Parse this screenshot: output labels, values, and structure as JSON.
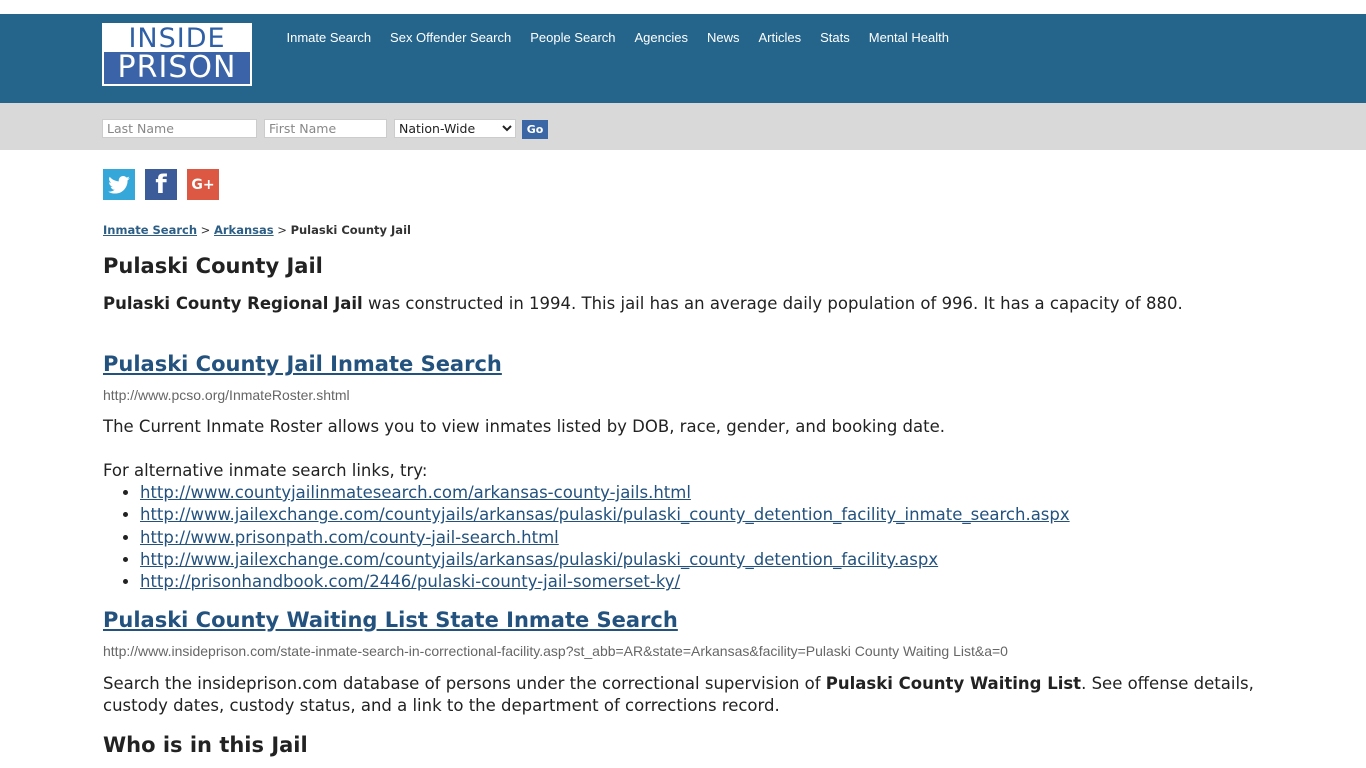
{
  "logo": {
    "line1": "INSIDE",
    "line2": "PRISON"
  },
  "nav": [
    {
      "label": "Inmate Search"
    },
    {
      "label": "Sex Offender Search"
    },
    {
      "label": "People Search"
    },
    {
      "label": "Agencies"
    },
    {
      "label": "News"
    },
    {
      "label": "Articles"
    },
    {
      "label": "Stats"
    },
    {
      "label": "Mental Health"
    }
  ],
  "search": {
    "last_name_placeholder": "Last Name",
    "first_name_placeholder": "First Name",
    "scope_selected": "Nation-Wide",
    "go_label": "Go"
  },
  "social": {
    "twitter": "t",
    "facebook": "f",
    "googleplus": "G+"
  },
  "breadcrumb": {
    "item1": "Inmate Search",
    "sep": " > ",
    "item2": "Arkansas",
    "current": "Pulaski County Jail"
  },
  "page": {
    "title": "Pulaski County Jail",
    "intro_bold": "Pulaski County Regional Jail",
    "intro_rest": " was constructed in 1994. This jail has an average daily population of 996. It has a capacity of 880.",
    "section1_title": "Pulaski County Jail Inmate Search",
    "section1_url": "http://www.pcso.org/InmateRoster.shtml",
    "section1_desc": "The Current Inmate Roster allows you to view inmates listed by DOB, race, gender, and booking date.",
    "alt_intro": "For alternative inmate search links, try:",
    "alt_links": [
      "http://www.countyjailinmatesearch.com/arkansas-county-jails.html",
      "http://www.jailexchange.com/countyjails/arkansas/pulaski/pulaski_county_detention_facility_inmate_search.aspx",
      "http://www.prisonpath.com/county-jail-search.html",
      "http://www.jailexchange.com/countyjails/arkansas/pulaski/pulaski_county_detention_facility.aspx",
      "http://prisonhandbook.com/2446/pulaski-county-jail-somerset-ky/"
    ],
    "section2_title": "Pulaski County Waiting List State Inmate Search",
    "section2_url": "http://www.insideprison.com/state-inmate-search-in-correctional-facility.asp?st_abb=AR&state=Arkansas&facility=Pulaski County Waiting List&a=0",
    "section2_desc_pre": "Search the insideprison.com database of persons under the correctional supervision of ",
    "section2_desc_bold": "Pulaski County Waiting List",
    "section2_desc_post": ". See offense details, custody dates, custody status, and a link to the department of corrections record.",
    "section3_title": "Who is in this Jail"
  }
}
